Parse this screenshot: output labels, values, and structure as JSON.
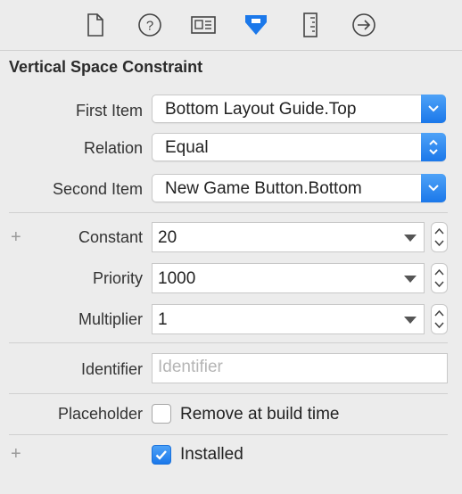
{
  "toolbar": {
    "icons": [
      "file-inspector-icon",
      "quick-help-icon",
      "identity-inspector-icon",
      "attributes-inspector-icon",
      "size-inspector-icon",
      "connections-inspector-icon"
    ],
    "selected": "attributes-inspector-icon"
  },
  "section": {
    "title": "Vertical Space Constraint"
  },
  "fields": {
    "first_item": {
      "label": "First Item",
      "value": "Bottom Layout Guide.Top"
    },
    "relation": {
      "label": "Relation",
      "value": "Equal"
    },
    "second_item": {
      "label": "Second Item",
      "value": "New Game Button.Bottom"
    },
    "constant": {
      "label": "Constant",
      "value": "20"
    },
    "priority": {
      "label": "Priority",
      "value": "1000"
    },
    "multiplier": {
      "label": "Multiplier",
      "value": "1"
    },
    "identifier": {
      "label": "Identifier",
      "value": "",
      "placeholder": "Identifier"
    },
    "placeholder": {
      "label": "Placeholder",
      "checkbox_label": "Remove at build time",
      "checked": false
    },
    "installed": {
      "checkbox_label": "Installed",
      "checked": true
    }
  },
  "colors": {
    "accent": "#1b78ea",
    "background": "#ececec"
  }
}
